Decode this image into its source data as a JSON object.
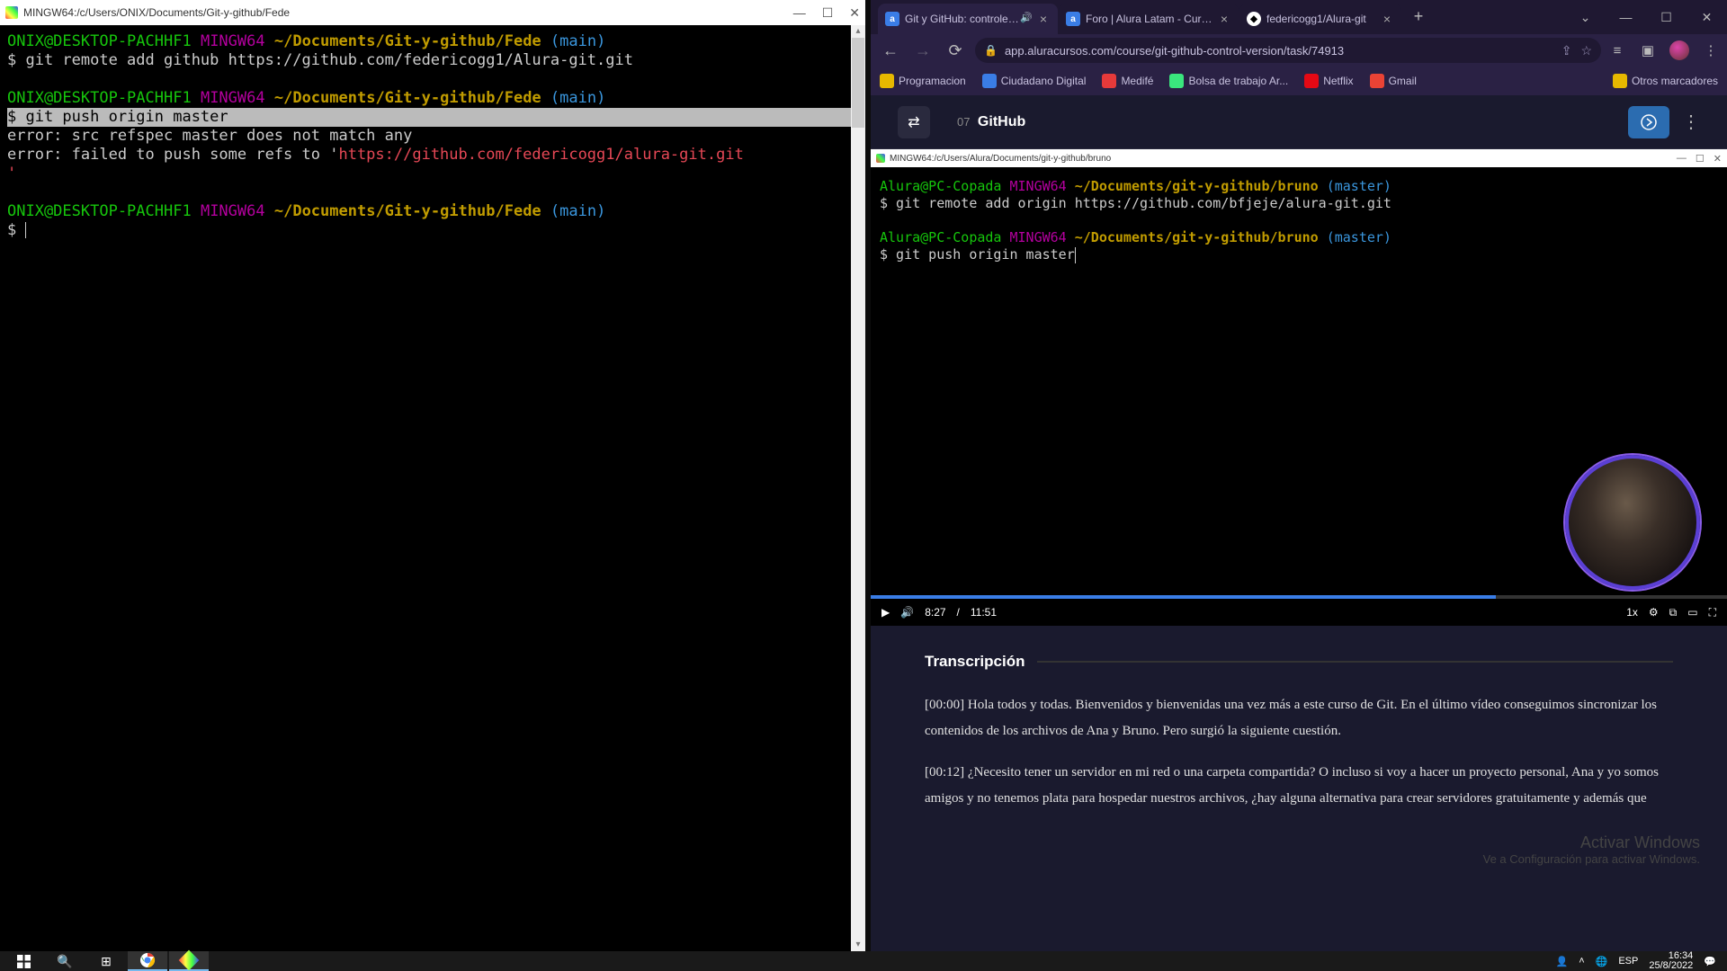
{
  "left_terminal": {
    "title": "MINGW64:/c/Users/ONIX/Documents/Git-y-github/Fede",
    "prompt1_user": "ONIX@DESKTOP-PACHHF1",
    "prompt1_sys": "MINGW64",
    "prompt1_path": "~/Documents/Git-y-github/Fede",
    "prompt1_branch": "(main)",
    "cmd1": "$ git remote add github https://github.com/federicogg1/Alura-git.git",
    "cmd2": "$ git push origin master",
    "err1": "error: src refspec master does not match any",
    "err2a": "error: failed to push some refs to '",
    "err2b": "https://github.com/federicogg1/alura-git.git",
    "err3": "'",
    "prompt_last": "$ "
  },
  "browser": {
    "tabs": [
      {
        "favicon": "a",
        "title": "Git y GitHub: controle y co",
        "audio": true
      },
      {
        "favicon": "a",
        "title": "Foro | Alura Latam - Cursos on"
      },
      {
        "favicon": "gh",
        "title": "federicogg1/Alura-git"
      }
    ],
    "url": "app.aluracursos.com/course/git-github-control-version/task/74913",
    "bookmarks": [
      {
        "color": "yellow",
        "label": "Programacion"
      },
      {
        "color": "blue",
        "label": "Ciudadano Digital"
      },
      {
        "color": "red",
        "label": "Medifé"
      },
      {
        "color": "grn",
        "label": "Bolsa de trabajo Ar..."
      },
      {
        "color": "nfx",
        "label": "Netflix"
      },
      {
        "color": "gm",
        "label": "Gmail"
      }
    ],
    "bookmarks_more": "Otros marcadores"
  },
  "lesson": {
    "num": "07",
    "name": "GitHub"
  },
  "video_terminal": {
    "title": "MINGW64:/c/Users/Alura/Documents/git-y-github/bruno",
    "p_user": "Alura@PC-Copada",
    "p_sys": "MINGW64",
    "p_path": "~/Documents/git-y-github/bruno",
    "p_branch": "(master)",
    "cmd1": "$ git remote add origin https://github.com/bfjeje/alura-git.git",
    "cmd2": "$ git push origin master"
  },
  "video_controls": {
    "time": "8:27",
    "duration": "11:51",
    "speed": "1x"
  },
  "transcript": {
    "heading": "Transcripción",
    "p1_ts": "[00:00]",
    "p1": " Hola todos y todas. Bienvenidos y bienvenidas una vez más a este curso de Git. En el último vídeo conseguimos sincronizar los contenidos de los archivos de Ana y Bruno. Pero surgió la siguiente cuestión.",
    "p2_ts": "[00:12]",
    "p2": " ¿Necesito tener un servidor en mi red o una carpeta compartida? O incluso si voy a hacer un proyecto personal, Ana y yo somos amigos y no tenemos plata para hospedar nuestros archivos, ¿hay alguna alternativa para crear servidores gratuitamente y además que"
  },
  "watermark": {
    "line1": "Activar Windows",
    "line2": "Ve a Configuración para activar Windows."
  },
  "taskbar": {
    "lang": "ESP",
    "time": "16:34",
    "date": "25/8/2022"
  }
}
